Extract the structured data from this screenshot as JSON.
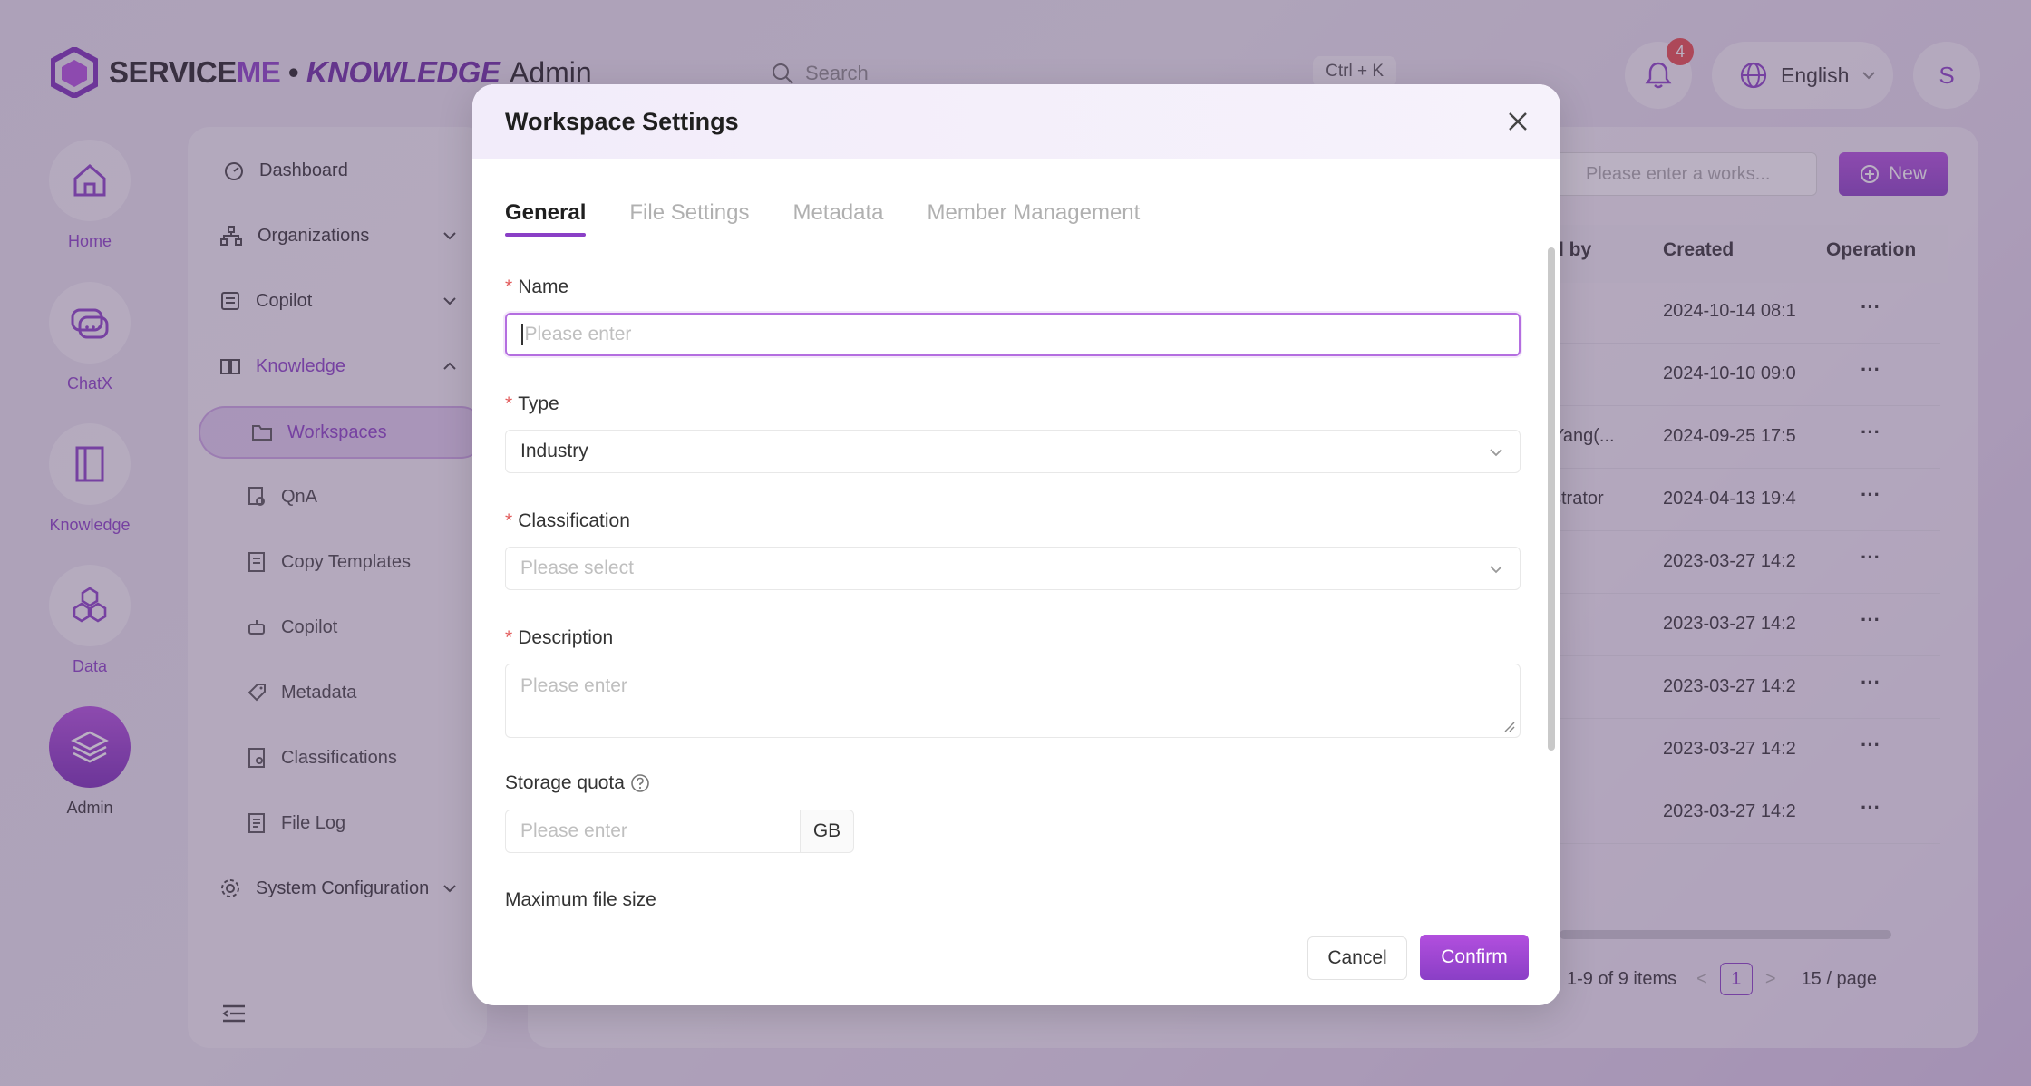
{
  "brand": {
    "name_part1": "SERVICE",
    "name_part2": "ME",
    "separator": "•",
    "name_part3": "KNOWLEDGE"
  },
  "header": {
    "section_title": "Admin",
    "search_placeholder": "Search",
    "search_shortcut": "Ctrl + K",
    "notification_count": "4",
    "language": "English",
    "avatar_initial": "S"
  },
  "rail": [
    {
      "label": "Home",
      "icon": "home-icon"
    },
    {
      "label": "ChatX",
      "icon": "chat-icon"
    },
    {
      "label": "Knowledge",
      "icon": "book-icon"
    },
    {
      "label": "Data",
      "icon": "hexagons-icon"
    },
    {
      "label": "Admin",
      "icon": "layers-icon",
      "active": true
    }
  ],
  "sidenav": {
    "items": [
      {
        "label": "Dashboard",
        "icon": "dashboard-icon"
      },
      {
        "label": "Organizations",
        "icon": "org-icon"
      },
      {
        "label": "Copilot",
        "icon": "copilot-icon"
      },
      {
        "label": "Knowledge",
        "icon": "knowledge-icon"
      },
      {
        "label": "System Configuration",
        "icon": "gear-icon"
      }
    ],
    "knowledge_sub": [
      {
        "label": "Workspaces",
        "icon": "folder-icon",
        "selected": true
      },
      {
        "label": "QnA",
        "icon": "qna-icon"
      },
      {
        "label": "Copy Templates",
        "icon": "template-icon"
      },
      {
        "label": "Copilot",
        "icon": "robot-icon"
      },
      {
        "label": "Metadata",
        "icon": "tag-icon"
      },
      {
        "label": "Classifications",
        "icon": "classification-icon"
      },
      {
        "label": "File Log",
        "icon": "file-log-icon"
      }
    ]
  },
  "table": {
    "search_placeholder": "Please enter a works...",
    "new_label": "New",
    "columns": [
      "d by",
      "Created",
      "Operation"
    ],
    "rows": [
      {
        "by": "",
        "created": "2024-10-14 08:1",
        "op": "···"
      },
      {
        "by": "",
        "created": "2024-10-10 09:0",
        "op": "···"
      },
      {
        "by": "Yang(...",
        "created": "2024-09-25 17:5",
        "op": "···"
      },
      {
        "by": "strator",
        "created": "2024-04-13 19:4",
        "op": "···"
      },
      {
        "by": "",
        "created": "2023-03-27 14:2",
        "op": "···"
      },
      {
        "by": "",
        "created": "2023-03-27 14:2",
        "op": "···"
      },
      {
        "by": "",
        "created": "2023-03-27 14:2",
        "op": "···"
      },
      {
        "by": "",
        "created": "2023-03-27 14:2",
        "op": "···"
      },
      {
        "by": "",
        "created": "2023-03-27 14:2",
        "op": "···"
      }
    ],
    "pagination": {
      "summary": "1-9 of 9 items",
      "prev": "<",
      "page": "1",
      "next": ">",
      "page_size": "15 / page"
    }
  },
  "modal": {
    "title": "Workspace Settings",
    "tabs": [
      "General",
      "File Settings",
      "Metadata",
      "Member Management"
    ],
    "active_tab": "General",
    "fields": {
      "name": {
        "label": "Name",
        "placeholder": "Please enter"
      },
      "type": {
        "label": "Type",
        "value": "Industry"
      },
      "classification": {
        "label": "Classification",
        "placeholder": "Please select"
      },
      "description": {
        "label": "Description",
        "placeholder": "Please enter"
      },
      "storage_quota": {
        "label": "Storage quota",
        "placeholder": "Please enter",
        "unit": "GB"
      },
      "max_file_size": {
        "label": "Maximum file size"
      }
    },
    "required_mark": "*",
    "cancel_label": "Cancel",
    "confirm_label": "Confirm"
  },
  "colors": {
    "accent": "#8a3fc6",
    "required": "#e25c5c",
    "badge": "#e84a4a"
  }
}
